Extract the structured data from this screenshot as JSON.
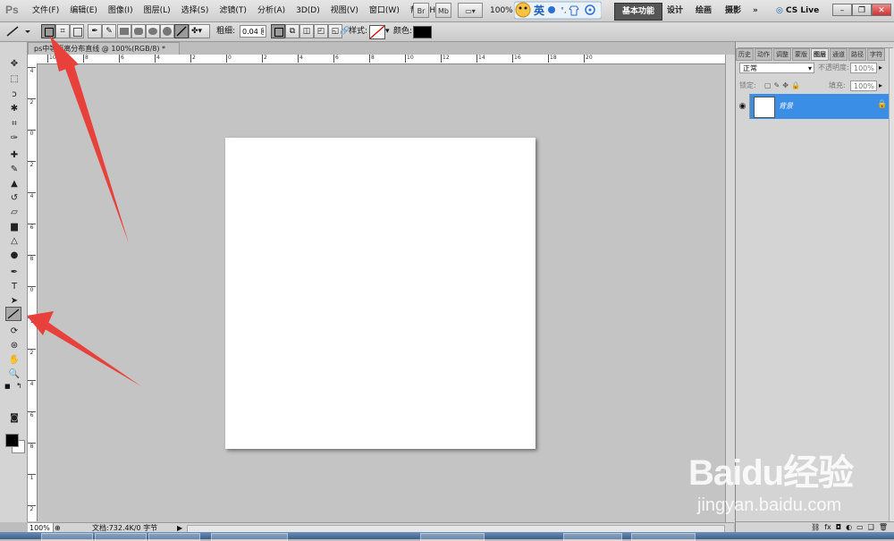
{
  "app": {
    "logo": "Ps"
  },
  "menu": {
    "items": [
      "文件(F)",
      "编辑(E)",
      "图像(I)",
      "图层(L)",
      "选择(S)",
      "滤镜(T)",
      "分析(A)",
      "3D(D)",
      "视图(V)",
      "窗口(W)",
      "帮助(H)"
    ]
  },
  "appbar": {
    "zoom": "100%",
    "br_label": "Br",
    "mb_label": "Mb"
  },
  "ime": {
    "label": "英"
  },
  "workspaces": {
    "active": "基本功能",
    "items": [
      "设计",
      "绘画",
      "摄影"
    ],
    "more": "»"
  },
  "cslive": "CS Live",
  "options": {
    "weight_label": "粗细:",
    "weight_value": "0.04 厘",
    "style_label": "样式:",
    "color_label": "颜色:",
    "color": "#000000"
  },
  "document": {
    "tab_title": "ps中等距离分布直线 @ 100%(RGB/8) *",
    "zoom": "100%",
    "status": "文档:732.4K/0 字节"
  },
  "rulers": {
    "h_labels": [
      "10",
      "8",
      "6",
      "4",
      "2",
      "0",
      "2",
      "4",
      "6",
      "8",
      "10",
      "12",
      "14",
      "16",
      "18",
      "20"
    ],
    "v_labels": [
      "4",
      "2",
      "0",
      "2",
      "4",
      "6",
      "8",
      "0",
      "1",
      "2",
      "4",
      "6",
      "8",
      "1",
      "2"
    ]
  },
  "layers_panel": {
    "tabs": [
      "历史",
      "动作",
      "调整",
      "蒙版",
      "图层",
      "通道",
      "路径",
      "字符"
    ],
    "active_tab": "图层",
    "blend_mode": "正常",
    "opacity_label": "不透明度:",
    "opacity": "100%",
    "lock_label": "锁定:",
    "fill_label": "填充:",
    "fill": "100%",
    "layers": [
      {
        "name": "背景",
        "locked": true,
        "visible": true
      }
    ]
  },
  "watermark": {
    "main": "Baidu经验",
    "sub": "jingyan.baidu.com"
  },
  "colors": {
    "layer_selected": "#3a8ee6",
    "annotation_arrow": "#e8403a"
  }
}
